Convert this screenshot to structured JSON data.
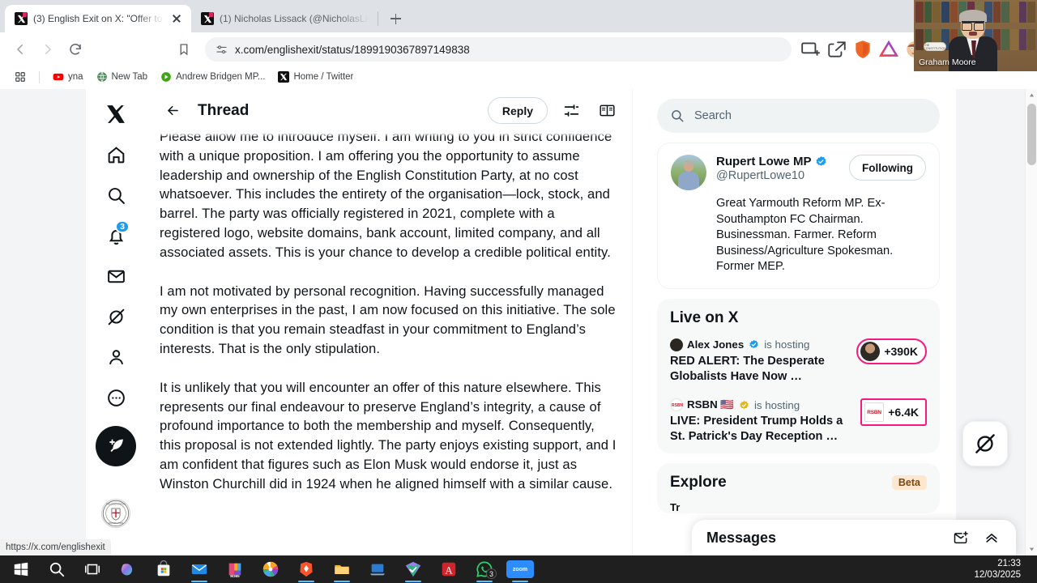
{
  "browser": {
    "tabs": [
      {
        "title": "(3) English Exit on X: \"Offer to (",
        "active": true,
        "favicon": "x-favicon"
      },
      {
        "title": "(1) Nicholas Lissack (@NicholasLiss",
        "active": false,
        "favicon": "x-favicon"
      }
    ],
    "new_tab_label": "+",
    "url": "x.com/englishexit/status/1899190367897149838",
    "nav": {
      "back": "back-arrow",
      "forward": "forward-arrow",
      "reload": "reload-icon",
      "bookmark": "bookmark-icon"
    },
    "toolbar_icons": [
      "split-view-icon",
      "share-icon",
      "brave-shields-icon",
      "brave-rewards-icon",
      "profile-avatar-icon",
      "google-translate-icon",
      "extensions-icon",
      "sidebar-icon",
      "wallet-icon"
    ],
    "bookmarks": [
      {
        "label": "yna",
        "icon": "youtube-icon"
      },
      {
        "label": "New Tab",
        "icon": "globe-icon"
      },
      {
        "label": "Andrew Bridgen MP...",
        "icon": "odysee-icon"
      },
      {
        "label": "Home / Twitter",
        "icon": "x-icon"
      }
    ],
    "apps_grid_label": "apps-grid",
    "status_link": "https://x.com/englishexit"
  },
  "pip": {
    "speaker_name": "Graham Moore",
    "card_text": "THE CONSTITUTION"
  },
  "x_app": {
    "left_nav": [
      {
        "name": "x-logo",
        "label": "X"
      },
      {
        "name": "home",
        "label": "Home"
      },
      {
        "name": "search",
        "label": "Explore"
      },
      {
        "name": "notifications",
        "label": "Notifications",
        "badge": "3"
      },
      {
        "name": "messages",
        "label": "Messages"
      },
      {
        "name": "grok",
        "label": "Grok"
      },
      {
        "name": "profile",
        "label": "Profile"
      },
      {
        "name": "more",
        "label": "More"
      }
    ],
    "compose_label": "Post",
    "avatar_label": "English Constitution Party",
    "header": {
      "back": "Back",
      "title": "Thread",
      "reply_label": "Reply",
      "settings_icon": "sliders-icon",
      "reader_icon": "reader-mode-icon"
    },
    "tweet": {
      "paragraphs": [
        "Please allow me to introduce myself. I am writing to you in strict confidence with a unique proposition. I am offering you the opportunity to assume leadership and ownership of the English Constitution Party, at no cost whatsoever. This includes the entirety of the organisation—lock, stock, and barrel. The party was officially registered in 2021, complete with a registered logo, website domains, bank account, limited company, and all associated assets. This is your chance to develop a credible political entity.",
        "I am not motivated by personal recognition. Having successfully managed my own enterprises in the past, I am now focused on this initiative. The sole condition is that you remain steadfast in your commitment to England’s interests. That is the only stipulation.",
        "It is unlikely that you will encounter an offer of this nature elsewhere. This represents our final endeavour to preserve England’s integrity, a cause of profound importance to both the membership and myself. Consequently, this proposal is not extended lightly. The party enjoys existing support, and I am confident that figures such as Elon Musk would endorse it, just as Winston Churchill did in 1924 when he aligned himself with a similar cause."
      ]
    },
    "search": {
      "placeholder": "Search",
      "icon": "search-icon"
    },
    "profile_card": {
      "name": "Rupert Lowe MP",
      "verified": true,
      "handle": "@RupertLowe10",
      "follow_label": "Following",
      "bio": "Great Yarmouth Reform MP. Ex-Southampton FC Chairman. Businessman. Farmer. Reform Business/Agriculture Spokesman. Former MEP."
    },
    "live_on_x": {
      "title": "Live on X",
      "items": [
        {
          "host": "Alex Jones",
          "verified_type": "blue",
          "hosting_text": "is hosting",
          "title": "RED ALERT: The Desperate Globalists Have Now …",
          "count": "+390K",
          "pill_shape": "round"
        },
        {
          "host": "RSBN 🇺🇸",
          "verified_type": "gold",
          "hosting_text": "is hosting",
          "title": "LIVE: President Trump Holds a St. Patrick's Day Reception …",
          "count": "+6.4K",
          "pill_shape": "square"
        }
      ]
    },
    "explore": {
      "title": "Explore",
      "badge": "Beta",
      "peek_text": "Tr"
    },
    "grok_fab": "grok-icon",
    "messages_dock": {
      "title": "Messages",
      "new_message_icon": "new-message-icon",
      "expand_icon": "chevron-up-icon"
    }
  },
  "taskbar": {
    "items": [
      {
        "name": "start-button",
        "label": "Start"
      },
      {
        "name": "search-button",
        "label": "Search"
      },
      {
        "name": "task-view-button",
        "label": "Task View"
      },
      {
        "name": "copilot",
        "label": "Copilot"
      },
      {
        "name": "microsoft-store",
        "label": "Microsoft Store"
      },
      {
        "name": "mail",
        "label": "Mail"
      },
      {
        "name": "microsoft-365",
        "label": "M365"
      },
      {
        "name": "photos",
        "label": "Photos"
      },
      {
        "name": "brave-browser",
        "label": "Brave"
      },
      {
        "name": "file-explorer",
        "label": "File Explorer"
      },
      {
        "name": "remote-desktop",
        "label": "Remote Desktop"
      },
      {
        "name": "microsoft-todo",
        "label": "To Do"
      },
      {
        "name": "adobe-acrobat",
        "label": "Acrobat Reader"
      },
      {
        "name": "whatsapp",
        "label": "WhatsApp",
        "badge": "3"
      },
      {
        "name": "zoom",
        "label": "zoom"
      }
    ],
    "clock_time": "21:33",
    "clock_date": "12/03/2025"
  },
  "colors": {
    "accent_blue": "#1d9bf0",
    "live_pink": "#f91880",
    "dark": "#0f1419",
    "muted": "#536471",
    "beta_bg": "#fde7cf"
  }
}
